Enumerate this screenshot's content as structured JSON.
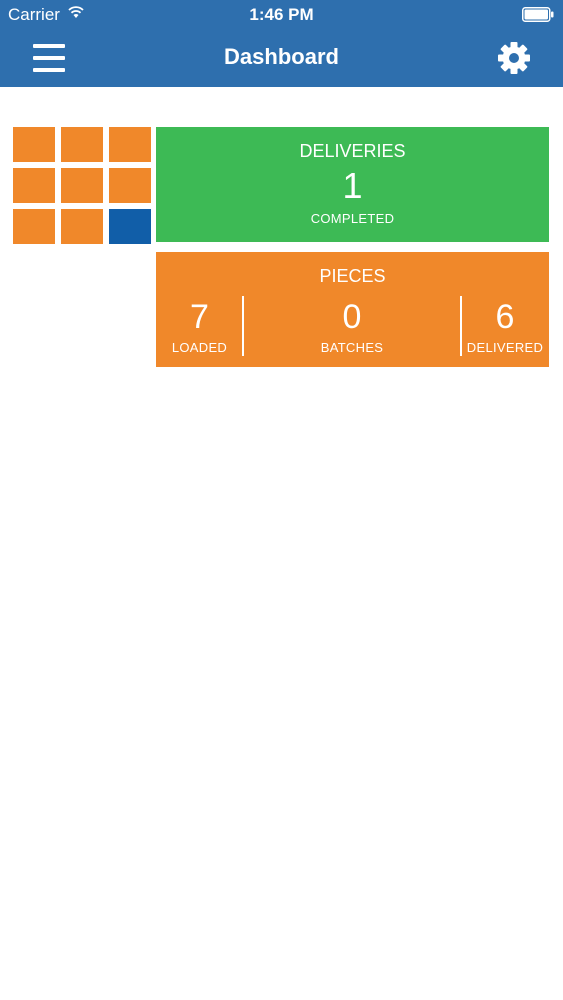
{
  "status_bar": {
    "carrier": "Carrier",
    "time": "1:46 PM"
  },
  "nav": {
    "title": "Dashboard",
    "menu_icon": "hamburger-menu-icon",
    "settings_icon": "gear-icon"
  },
  "tile_grid": {
    "rows": 3,
    "cols": 3,
    "active_index": 8,
    "colors": {
      "tile": "#f0882a",
      "active": "#115ea8"
    }
  },
  "deliveries": {
    "title": "DELIVERIES",
    "value": "1",
    "caption": "COMPLETED",
    "color": "#3dba55"
  },
  "pieces": {
    "title": "PIECES",
    "color": "#f0882a",
    "stats": [
      {
        "value": "7",
        "label": "LOADED"
      },
      {
        "value": "0",
        "label": "BATCHES"
      },
      {
        "value": "6",
        "label": "DELIVERED"
      }
    ]
  },
  "colors": {
    "header": "#2e6fae",
    "background": "#ffffff"
  }
}
